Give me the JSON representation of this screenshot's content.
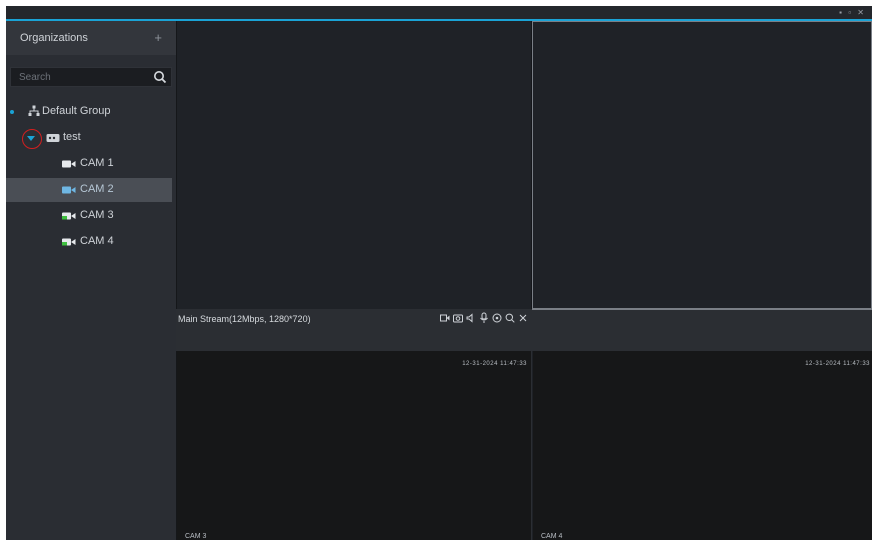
{
  "sidebar": {
    "header": "Organizations",
    "add_symbol": "+",
    "search_placeholder": "Search",
    "tree": {
      "group": "Default Group",
      "site": "test",
      "cameras": [
        "CAM 1",
        "CAM 2",
        "CAM 3",
        "CAM 4"
      ],
      "selected_index": 1
    }
  },
  "toolbar": {
    "window_controls": "▪ ▫ ✕"
  },
  "video": {
    "stream_label": "Main Stream(12Mbps, 1280*720)",
    "pane3_timestamp": "12-31-2024 11:47:33",
    "pane4_timestamp": "12-31-2024 11:47:33",
    "pane3_caption": "CAM 3",
    "pane4_caption": "CAM 4"
  },
  "colors": {
    "accent": "#1aa3d6",
    "camera_online": "#3fbf3f",
    "camera_selected": "#6fb7e3",
    "annotation_circle": "#d21f1f"
  }
}
